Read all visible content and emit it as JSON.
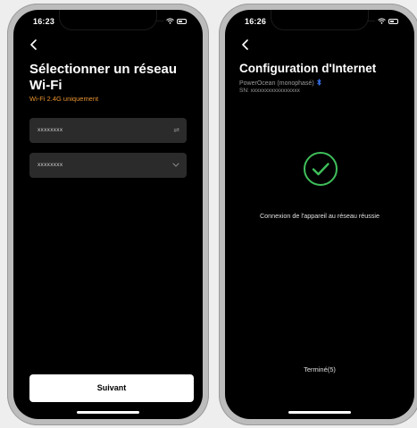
{
  "left_screen": {
    "time": "16:23",
    "title": "Sélectionner un réseau Wi-Fi",
    "subtitle": "Wi-Fi 2.4G uniquement",
    "network_field": {
      "value": "xxxxxxxx",
      "icon": "swap-icon"
    },
    "password_field": {
      "value": "xxxxxxxx",
      "icon": "chevron-down-icon"
    },
    "next_button": "Suivant"
  },
  "right_screen": {
    "time": "16:26",
    "title": "Configuration d'Internet",
    "device": "PowerOcean (monophasé)",
    "device_icon": "bluetooth-icon",
    "serial": "SN: xxxxxxxxxxxxxxxxx",
    "success_message": "Connexion de l'appareil au réseau réussie",
    "done_label": "Terminé(5)"
  },
  "colors": {
    "accent_orange": "#e8932f",
    "success_green": "#3fbf5a",
    "bluetooth_blue": "#3b7bff"
  }
}
